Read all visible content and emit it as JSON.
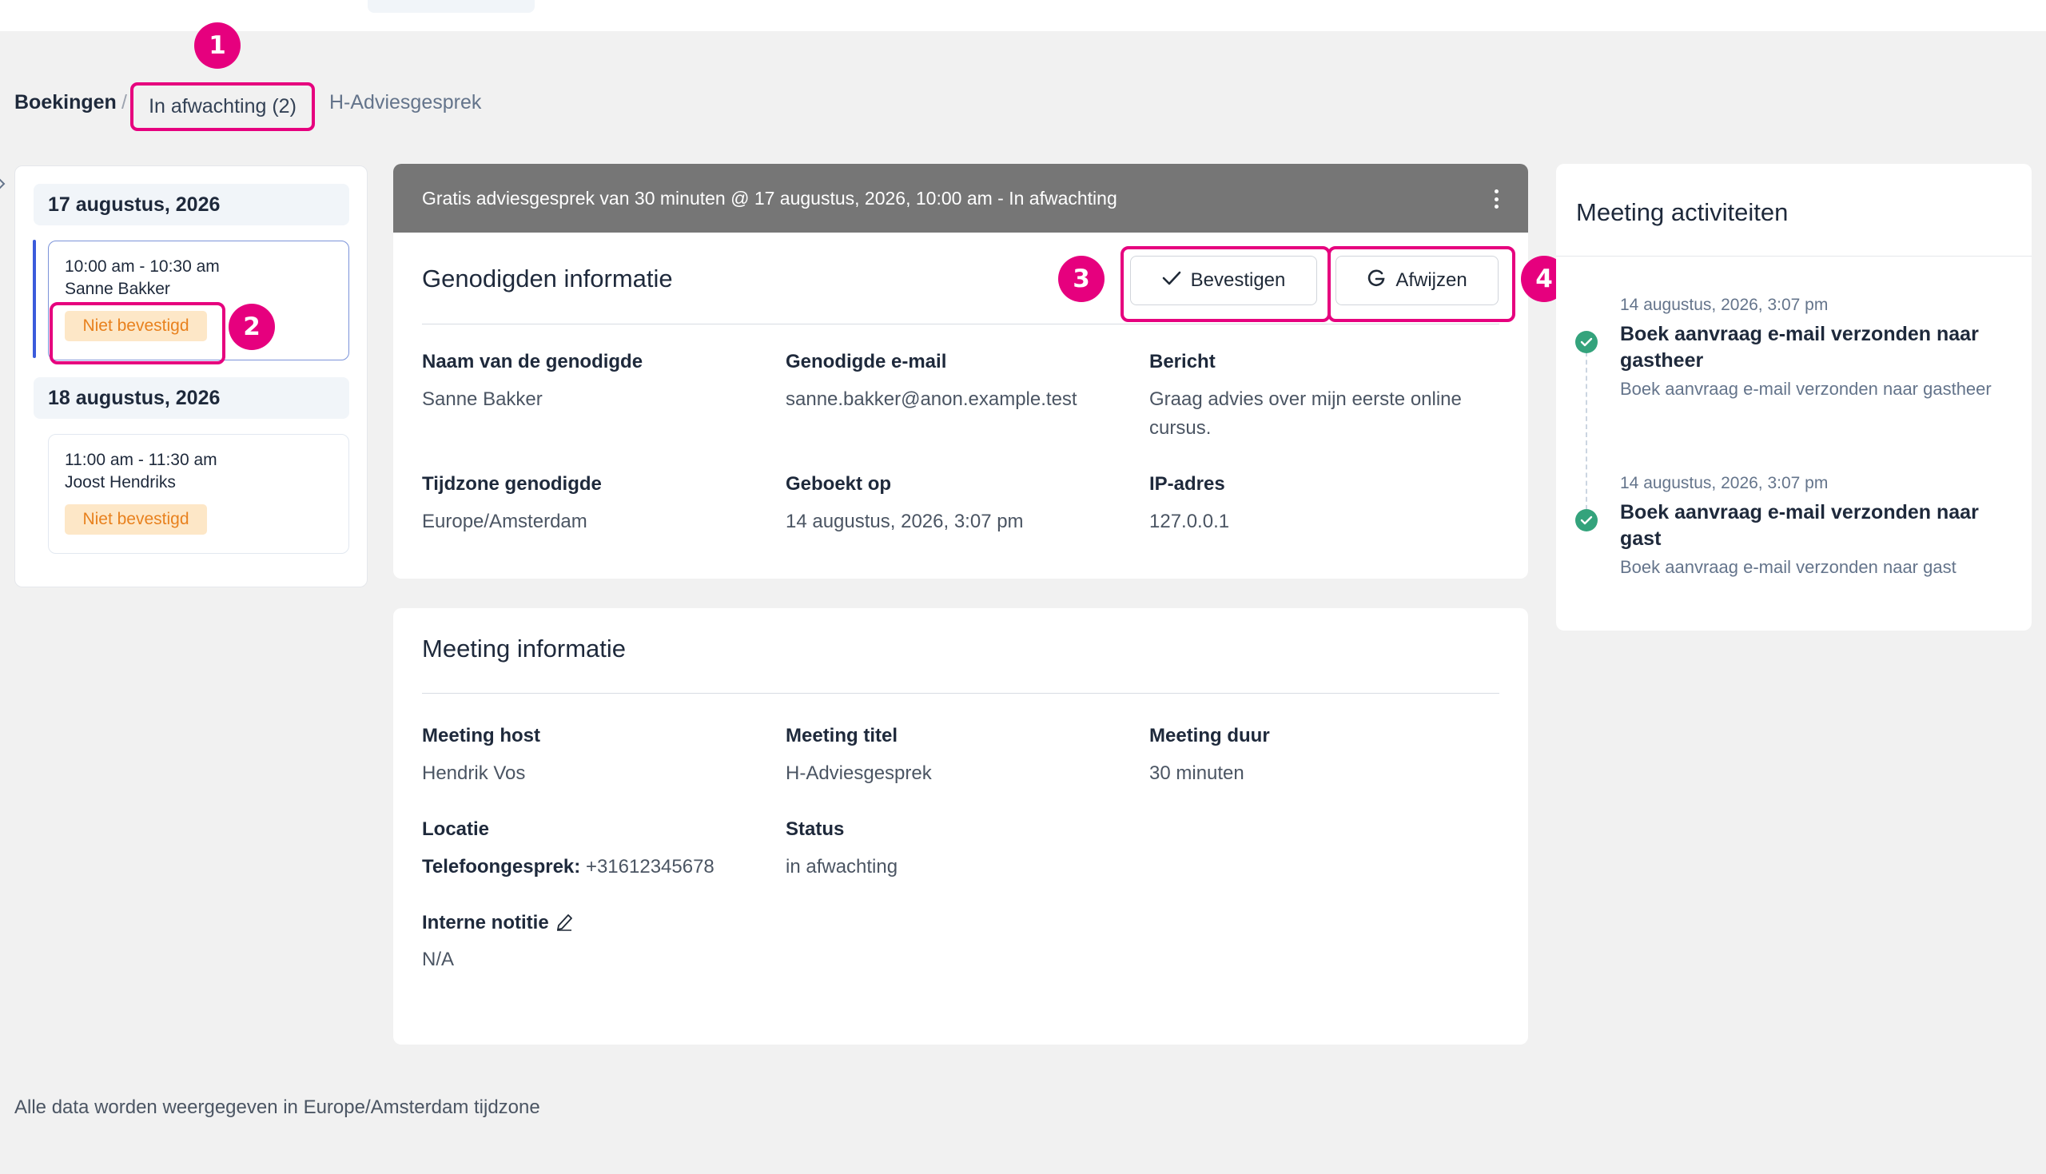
{
  "breadcrumb": {
    "root": "Boekingen",
    "separator": "/",
    "pending": "In afwachting (2)",
    "current": "H-Adviesgesprek"
  },
  "markers": [
    "1",
    "2",
    "3",
    "4"
  ],
  "booking_list": {
    "groups": [
      {
        "date": "17 augustus, 2026",
        "slots": [
          {
            "time": "10:00 am - 10:30 am",
            "name": "Sanne Bakker",
            "status": "Niet bevestigd"
          }
        ]
      },
      {
        "date": "18 augustus, 2026",
        "slots": [
          {
            "time": "11:00 am - 11:30 am",
            "name": "Joost Hendriks",
            "status": "Niet bevestigd"
          }
        ]
      }
    ]
  },
  "booking": {
    "header": "Gratis adviesgesprek van 30 minuten @ 17 augustus, 2026, 10:00 am - In afwachting",
    "guest_section_title": "Genodigden informatie",
    "confirm_label": "Bevestigen",
    "reject_label": "Afwijzen",
    "guest_fields": [
      {
        "label": "Naam van de genodigde",
        "value": "Sanne Bakker"
      },
      {
        "label": "Genodigde e-mail",
        "value": "sanne.bakker@anon.example.test"
      },
      {
        "label": "Bericht",
        "value": "Graag advies over mijn eerste online cursus."
      },
      {
        "label": "Tijdzone genodigde",
        "value": "Europe/Amsterdam"
      },
      {
        "label": "Geboekt op",
        "value": "14 augustus, 2026, 3:07 pm"
      },
      {
        "label": "IP-adres",
        "value": "127.0.0.1"
      }
    ],
    "meeting_section_title": "Meeting informatie",
    "meeting_fields": [
      {
        "label": "Meeting host",
        "value": "Hendrik Vos"
      },
      {
        "label": "Meeting titel",
        "value": "H-Adviesgesprek"
      },
      {
        "label": "Meeting duur",
        "value": "30 minuten"
      },
      {
        "label": "Locatie",
        "value_prefix": "Telefoongesprek:",
        "value": "+31612345678"
      },
      {
        "label": "Status",
        "value": "in afwachting"
      },
      {
        "label": "Interne notitie",
        "value": "N/A"
      }
    ]
  },
  "activities": {
    "title": "Meeting activiteiten",
    "items": [
      {
        "time": "14 augustus, 2026, 3:07 pm",
        "title": "Boek aanvraag e-mail verzonden naar gastheer",
        "desc": "Boek aanvraag e-mail verzonden naar gastheer"
      },
      {
        "time": "14 augustus, 2026, 3:07 pm",
        "title": "Boek aanvraag e-mail verzonden naar gast",
        "desc": "Boek aanvraag e-mail verzonden naar gast"
      }
    ]
  },
  "footer": {
    "note": "Alle data worden weergegeven in Europe/Amsterdam tijdzone"
  },
  "colors": {
    "highlight": "#e6007e",
    "header_gray": "#767676",
    "badge_bg": "#fde7c7",
    "badge_text": "#e8811e",
    "success": "#34a37c"
  }
}
